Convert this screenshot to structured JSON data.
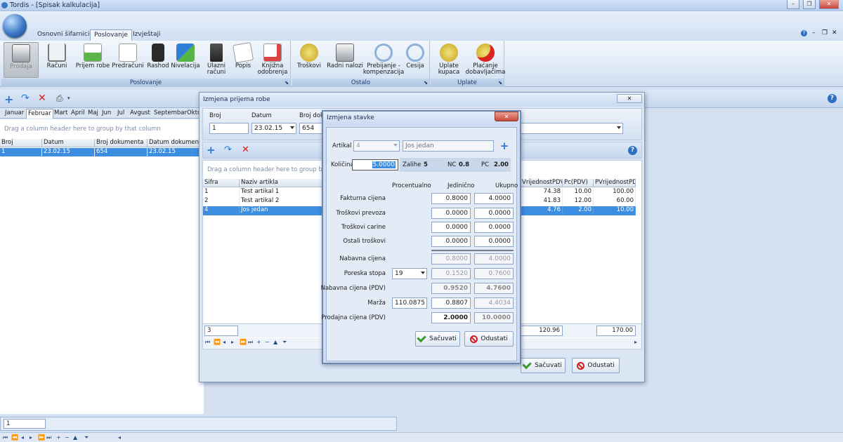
{
  "window": {
    "title": "Tordis - [Spisak kalkulacija]"
  },
  "ribbon": {
    "tabs": [
      "Osnovni šifarnici",
      "Poslovanje",
      "Izvještaji"
    ],
    "active_tab": "Poslovanje",
    "groups": [
      {
        "label": "Poslovanje",
        "buttons": [
          "Prodaja",
          "Računi",
          "Prijem robe",
          "Predračuni",
          "Rashod",
          "Nivelacija",
          "Ulazni\nračuni",
          "Popis",
          "Knjižna\nodobrenja"
        ]
      },
      {
        "label": "Ostalo",
        "buttons": [
          "Troškovi",
          "Radni nalozi",
          "Prebijanje -\nkompenzacija",
          "Cesija"
        ]
      },
      {
        "label": "Uplate",
        "buttons": [
          "Uplate\nkupaca",
          "Plaćanje\ndobavljačima"
        ]
      }
    ]
  },
  "months": [
    "Januar",
    "Februar",
    "Mart",
    "April",
    "Maj",
    "Jun",
    "Jul",
    "Avgust",
    "Septembar",
    "Okto"
  ],
  "active_month": "Februar",
  "main_grid": {
    "group_hint": "Drag a column header here to group by that column",
    "columns": [
      "Broj",
      "Datum",
      "Broj dokumenta",
      "Datum dokumenta"
    ],
    "rows": [
      [
        "1",
        "23.02.15",
        "654",
        "23.02.15"
      ]
    ],
    "footer_value": "1"
  },
  "receipt_dialog": {
    "title": "Izmjena prijema robe",
    "broj_label": "Broj",
    "broj_value": "1",
    "datum_label": "Datum",
    "datum_value": "23.02.15",
    "broj_dok_label": "Broj doku",
    "broj_dok_value": "654",
    "group_hint": "Drag a column header here to group by that col",
    "columns": [
      "Šifra",
      "Naziv artikla",
      "VrijednostPDV",
      "Pc(PDV)",
      "PVrijednostPDV"
    ],
    "rows": [
      [
        "1",
        "Test artikal 1",
        "74.38",
        "10.00",
        "100.00"
      ],
      [
        "2",
        "Test artikal 2",
        "41.83",
        "12.00",
        "60.00"
      ],
      [
        "4",
        "Jos jedan",
        "4.76",
        "2.00",
        "10.00"
      ]
    ],
    "footer_count": "3",
    "footer_total1": "120.96",
    "footer_total2": "170.00",
    "save_label": "Sačuvati",
    "cancel_label": "Odustati"
  },
  "item_dialog": {
    "title": "Izmjena stavke",
    "artikal_label": "Artikal",
    "artikal_code": "4",
    "artikal_name": "Jos jedan",
    "kolicina_label": "Količina",
    "kolicina_value": "5.0000",
    "zalihe_label": "Zalihe",
    "zalihe_value": "5",
    "nc_label": "NC",
    "nc_value": "0.8",
    "pc_label": "PC",
    "pc_value": "2.00",
    "col_procentualno": "Procentualno",
    "col_jedinicno": "Jedinično",
    "col_ukupno": "Ukupno",
    "rows": [
      {
        "label": "Fakturna cijena",
        "unit": "0.8000",
        "total": "4.0000"
      },
      {
        "label": "Troškovi prevoza",
        "unit": "0.0000",
        "total": "0.0000"
      },
      {
        "label": "Troškovi carine",
        "unit": "0.0000",
        "total": "0.0000"
      },
      {
        "label": "Ostali troškovi",
        "unit": "0.0000",
        "total": "0.0000"
      },
      {
        "label": "Nabavna cijena",
        "unit": "0.8000",
        "total": "4.0000"
      },
      {
        "label": "Poreska stopa",
        "percent": "19",
        "unit": "0.1520",
        "total": "0.7600"
      },
      {
        "label": "Nabavna cijena (PDV)",
        "unit": "0.9520",
        "total": "4.7600"
      },
      {
        "label": "Marža",
        "percent": "110.0875",
        "unit": "0.8807",
        "total": "4.4034"
      },
      {
        "label": "Prodajna cijena (PDV)",
        "unit": "2.0000",
        "total": "10.0000"
      }
    ],
    "save_label": "Sačuvati",
    "cancel_label": "Odustati"
  }
}
